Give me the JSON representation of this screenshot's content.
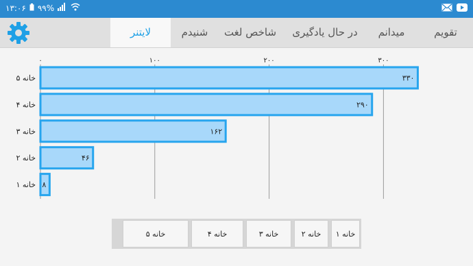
{
  "status_bar": {
    "time": "۱۳:۰۶",
    "battery": "۹۹%",
    "icons": [
      "battery-icon",
      "signal-icon",
      "wifi-icon",
      "mail-icon",
      "youtube-icon"
    ]
  },
  "tabs": [
    {
      "label": "لایتنر",
      "active": true
    },
    {
      "label": "شنیدم",
      "active": false
    },
    {
      "label": "شاخص لغت",
      "active": false
    },
    {
      "label": "در حال یادگیری",
      "active": false
    },
    {
      "label": "میدانم",
      "active": false
    },
    {
      "label": "تقویم",
      "active": false
    }
  ],
  "colors": {
    "status_bar": "#2c8ad0",
    "accent": "#1ea0e6",
    "bar_fill": "#a8d8fa",
    "bar_stroke": "#27a5ee"
  },
  "chart_data": {
    "type": "bar",
    "orientation": "horizontal",
    "categories": [
      "خانه ۵",
      "خانه ۴",
      "خانه ۳",
      "خانه ۲",
      "خانه ۱"
    ],
    "values": [
      330,
      290,
      162,
      46,
      8
    ],
    "value_labels": [
      "۳۳۰",
      "۲۹۰",
      "۱۶۲",
      "۴۶",
      "۸"
    ],
    "x_ticks": [
      0,
      100,
      200,
      300
    ],
    "x_tick_labels": [
      "۰",
      "۱۰۰",
      "۲۰۰",
      "۳۰۰"
    ],
    "xlim": [
      0,
      330
    ],
    "grid": true
  },
  "legend_buttons": [
    "خانه ۱",
    "خانه ۲",
    "خانه ۳",
    "خانه ۴",
    "خانه ۵"
  ]
}
